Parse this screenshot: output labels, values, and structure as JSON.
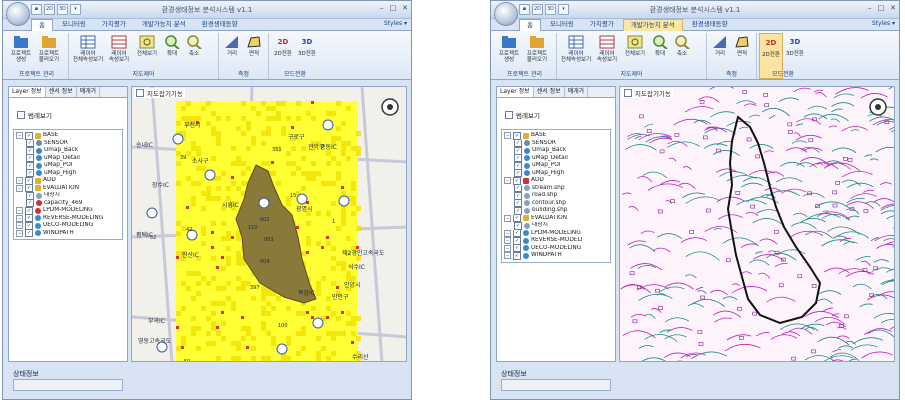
{
  "left_window": {
    "title": "환경생태정보 분석시스템 v1.1",
    "tabs": [
      "홈",
      "모니터링",
      "가치평가",
      "개발가능지 분석",
      "환경생태동향"
    ],
    "styles_label": "Styles ▾",
    "groups": [
      {
        "name": "프로젝트 관리",
        "buttons": [
          "프로젝트\n생성",
          "프로젝트\n불러오기"
        ]
      },
      {
        "name": "지도제어",
        "buttons": [
          "레이어\n전체속성보기",
          "레이어\n속성보기",
          "전체보기",
          "확대",
          "축소"
        ]
      },
      {
        "name": "측정",
        "buttons": [
          "거리",
          "면적"
        ]
      },
      {
        "name": "모드전환",
        "buttons": [
          "2D전환",
          "3D전환"
        ]
      }
    ],
    "left_tabs": [
      "Layer 정보",
      "센서 정보",
      "매개가"
    ],
    "legend_checkbox": "범례보기",
    "map_checkbox": "지도잡기기능",
    "tree": [
      {
        "label": "BASE",
        "level": 0,
        "kind": "folder"
      },
      {
        "label": "SENSOR",
        "level": 1,
        "kind": "sensor"
      },
      {
        "label": "Umap_Back",
        "level": 1,
        "kind": "globe"
      },
      {
        "label": "uMap_Detail",
        "level": 1,
        "kind": "globe"
      },
      {
        "label": "uMap_POI",
        "level": 1,
        "kind": "globe"
      },
      {
        "label": "uMap_High",
        "level": 1,
        "kind": "globe"
      },
      {
        "label": "ADD",
        "level": 0,
        "kind": "folder"
      },
      {
        "label": "EVALUATION",
        "level": 0,
        "kind": "folder"
      },
      {
        "label": "대상지",
        "level": 1,
        "kind": "layer"
      },
      {
        "label": "capacity_469",
        "level": 1,
        "kind": "layer-red"
      },
      {
        "label": "LPDM-MODELING",
        "level": 0,
        "kind": "check"
      },
      {
        "label": "REVERSE-MODELING",
        "level": 0,
        "kind": "globe"
      },
      {
        "label": "UECO-MODELING",
        "level": 0,
        "kind": "globe"
      },
      {
        "label": "WINDPATH",
        "level": 0,
        "kind": "globe"
      }
    ],
    "status_label": "상태정보",
    "map_labels": [
      "부천시",
      "송내IC",
      "시흥IC",
      "장수IC",
      "중동IC",
      "소사구",
      "구로구",
      "관악구",
      "평택IC",
      "안양시",
      "광명시",
      "제2경인고속국도",
      "석수IC",
      "목감IC",
      "만안구",
      "안산IC",
      "부곡IC",
      "영동고속국도",
      "수리산"
    ],
    "route_numbers": [
      "351",
      "42",
      "39",
      "110",
      "15",
      "1",
      "100",
      "397",
      "004",
      "002",
      "003",
      "52",
      "50"
    ]
  },
  "right_window": {
    "title": "환경생태정보 분석시스템 v1.1",
    "tabs": [
      "홈",
      "모니터링",
      "가치평가",
      "개발가능지 분석",
      "환경생태동향"
    ],
    "styles_label": "Styles ▾",
    "groups": [
      {
        "name": "프로젝트 관리",
        "buttons": [
          "프로젝트\n생성",
          "프로젝트\n불러오기"
        ]
      },
      {
        "name": "지도제어",
        "buttons": [
          "레이어\n전체속성보기",
          "레이어\n속성보기",
          "전체보기",
          "확대",
          "축소"
        ]
      },
      {
        "name": "측정",
        "buttons": [
          "거리",
          "면적"
        ]
      },
      {
        "name": "모드전환",
        "buttons": [
          "2D전환",
          "3D전환"
        ]
      }
    ],
    "left_tabs": [
      "Layer 정보",
      "센서 정보",
      "매개가"
    ],
    "legend_checkbox": "범례보기",
    "map_checkbox": "지도잡기기능",
    "tree": [
      {
        "label": "BASE",
        "level": 0,
        "kind": "folder"
      },
      {
        "label": "SENSOR",
        "level": 1,
        "kind": "sensor"
      },
      {
        "label": "Umap_Back",
        "level": 1,
        "kind": "globe"
      },
      {
        "label": "uMap_Detail",
        "level": 1,
        "kind": "globe"
      },
      {
        "label": "uMap_POI",
        "level": 1,
        "kind": "globe"
      },
      {
        "label": "uMap_High",
        "level": 1,
        "kind": "globe"
      },
      {
        "label": "ADD",
        "level": 0,
        "kind": "folder-red"
      },
      {
        "label": "stream.shp",
        "level": 1,
        "kind": "layer"
      },
      {
        "label": "road.shp",
        "level": 1,
        "kind": "layer"
      },
      {
        "label": "contour.shp",
        "level": 1,
        "kind": "layer"
      },
      {
        "label": "building.shp",
        "level": 1,
        "kind": "layer"
      },
      {
        "label": "EVALUATION",
        "level": 0,
        "kind": "folder"
      },
      {
        "label": "대상지",
        "level": 1,
        "kind": "layer"
      },
      {
        "label": "LPDM-MODELING",
        "level": 0,
        "kind": "globe"
      },
      {
        "label": "REVERSE-MODELI",
        "level": 0,
        "kind": "globe"
      },
      {
        "label": "UECO-MODELING",
        "level": 0,
        "kind": "globe"
      },
      {
        "label": "WINDPATH",
        "level": 0,
        "kind": "globe"
      }
    ],
    "status_label": "상태정보"
  }
}
